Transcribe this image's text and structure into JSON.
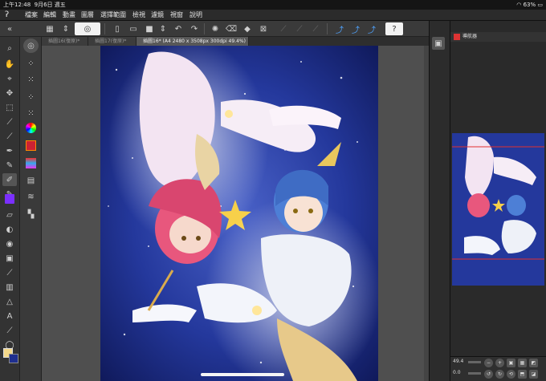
{
  "status_bar": {
    "time": "上午12:48",
    "date": "9月6日 週五",
    "battery": "63%"
  },
  "menu": {
    "items": [
      "檔案",
      "編輯",
      "動畫",
      "圖層",
      "選擇範圍",
      "檢視",
      "濾鏡",
      "視窗",
      "說明"
    ]
  },
  "tabs": [
    {
      "label": "插圖16(復原)*",
      "active": false
    },
    {
      "label": "插圖17(復原)*",
      "active": false
    },
    {
      "label": "插圖16* (A4 2480 x 3508px 300dpi 49.4%)",
      "active": true
    }
  ],
  "navigator": {
    "title": "導航器",
    "zoom": "49.4",
    "angle": "0.0"
  },
  "colors": {
    "main_color": "#f4d98a",
    "sub_color": "#1f2f8f",
    "purple_swatch": "#7b2fff",
    "accent_blue": "#4fa3ff"
  }
}
